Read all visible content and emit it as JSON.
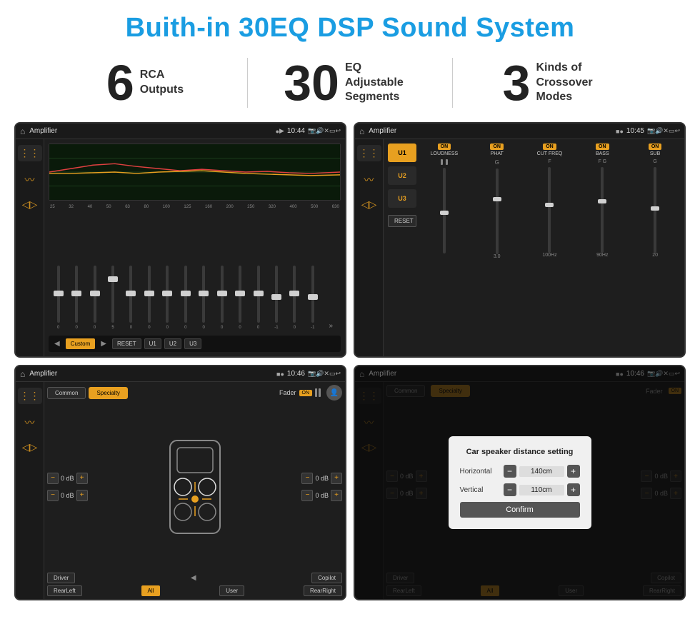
{
  "title": "Buith-in 30EQ DSP Sound System",
  "stats": [
    {
      "number": "6",
      "label": "RCA\nOutputs"
    },
    {
      "number": "30",
      "label": "EQ Adjustable\nSegments"
    },
    {
      "number": "3",
      "label": "Kinds of\nCrossover Modes"
    }
  ],
  "screens": [
    {
      "id": "eq-screen",
      "statusBar": {
        "title": "Amplifier",
        "time": "10:44"
      },
      "eqFreqs": [
        "25",
        "32",
        "40",
        "50",
        "63",
        "80",
        "100",
        "125",
        "160",
        "200",
        "250",
        "320",
        "400",
        "500",
        "630"
      ],
      "eqValues": [
        "0",
        "0",
        "0",
        "5",
        "0",
        "0",
        "0",
        "0",
        "0",
        "0",
        "0",
        "0",
        "-1",
        "0",
        "-1"
      ],
      "bottomButtons": [
        "◀",
        "Custom",
        "▶",
        "RESET",
        "U1",
        "U2",
        "U3"
      ]
    },
    {
      "id": "crossover-screen",
      "statusBar": {
        "title": "Amplifier",
        "time": "10:45"
      },
      "uButtons": [
        "U1",
        "U2",
        "U3"
      ],
      "controls": [
        "LOUDNESS",
        "PHAT",
        "CUT FREQ",
        "BASS",
        "SUB"
      ],
      "resetLabel": "RESET"
    },
    {
      "id": "fader-screen",
      "statusBar": {
        "title": "Amplifier",
        "time": "10:46"
      },
      "tabs": [
        "Common",
        "Specialty"
      ],
      "faderLabel": "Fader",
      "faderOnLabel": "ON",
      "dbValues": [
        "0 dB",
        "0 dB",
        "0 dB",
        "0 dB"
      ],
      "bottomButtons": [
        "Driver",
        "RearLeft",
        "All",
        "Copilot",
        "User",
        "RearRight"
      ]
    },
    {
      "id": "distance-screen",
      "statusBar": {
        "title": "Amplifier",
        "time": "10:46"
      },
      "tabs": [
        "Common",
        "Specialty"
      ],
      "dialog": {
        "title": "Car speaker distance setting",
        "fields": [
          {
            "label": "Horizontal",
            "value": "140cm"
          },
          {
            "label": "Vertical",
            "value": "110cm"
          }
        ],
        "confirmLabel": "Confirm"
      },
      "bottomButtons": [
        "Driver",
        "RearLeft",
        "All",
        "Copilot",
        "User",
        "RearRight"
      ]
    }
  ]
}
